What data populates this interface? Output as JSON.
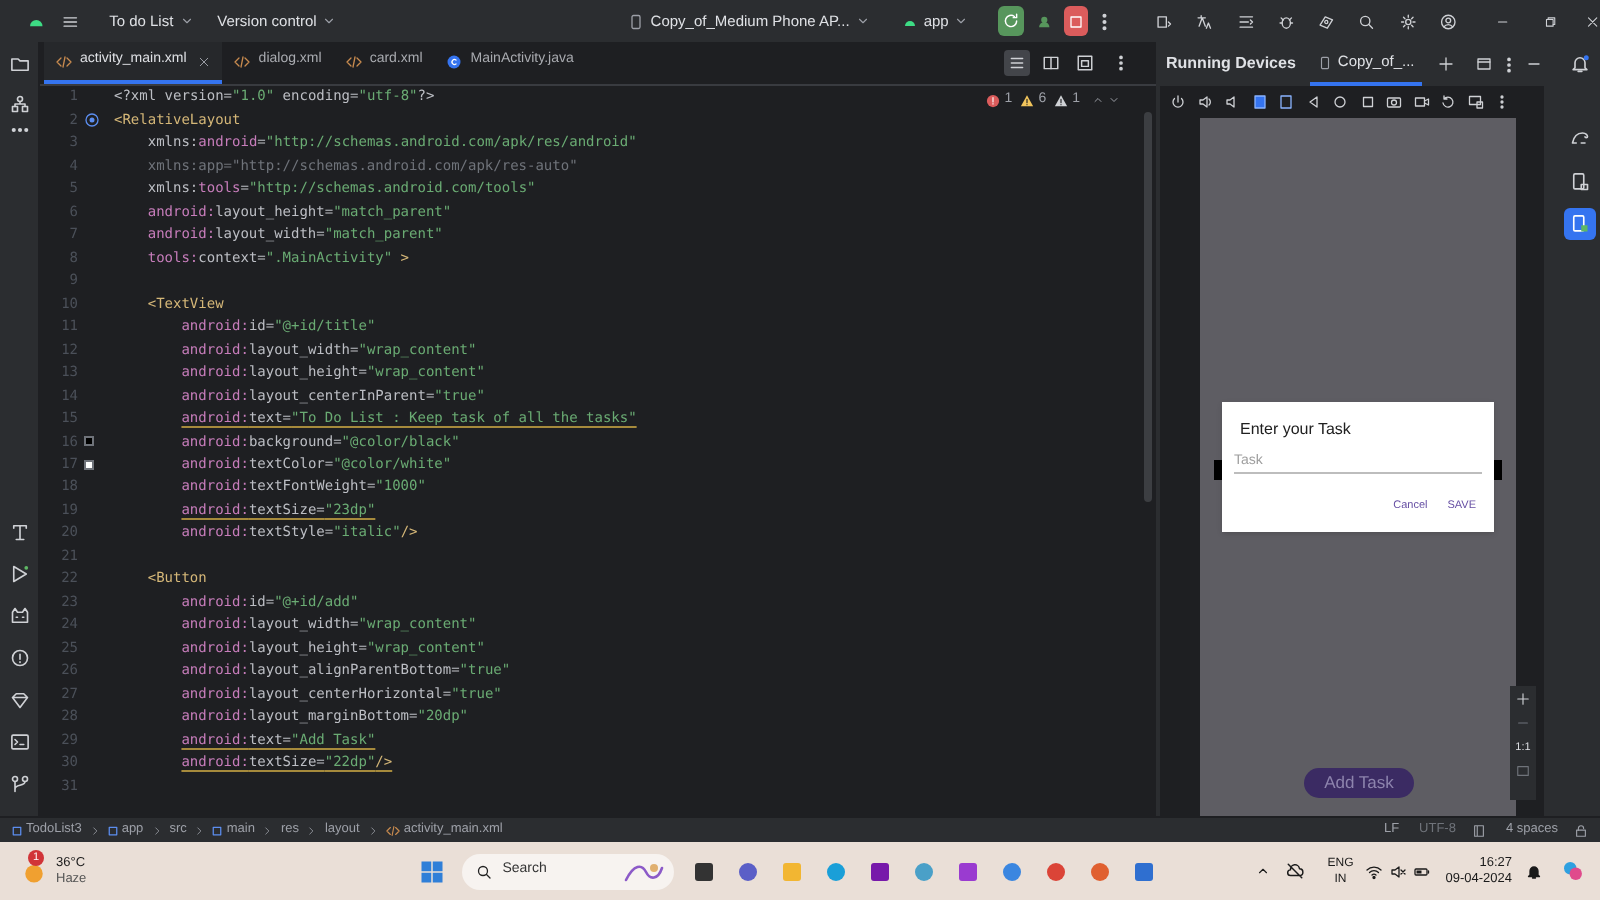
{
  "title_bar": {
    "project": "To do List",
    "vcs": "Version control",
    "device": "Copy_of_Medium Phone AP...",
    "run_config": "app"
  },
  "editor_tabs": [
    {
      "label": "activity_main.xml",
      "kind": "xml",
      "selected": true
    },
    {
      "label": "dialog.xml",
      "kind": "xml",
      "selected": false
    },
    {
      "label": "card.xml",
      "kind": "xml",
      "selected": false
    },
    {
      "label": "MainActivity.java",
      "kind": "java",
      "selected": false
    }
  ],
  "inspections": [
    {
      "kind": "error",
      "count": "1"
    },
    {
      "kind": "warning",
      "count": "6"
    },
    {
      "kind": "weak",
      "count": "1"
    }
  ],
  "code": [
    {
      "number": "1",
      "segments": [
        {
          "kind": "punct",
          "text": "<?xml "
        },
        {
          "kind": "attr",
          "text": "version="
        },
        {
          "kind": "value",
          "text": "\"1.0\""
        },
        {
          "kind": "attr",
          "text": " encoding="
        },
        {
          "kind": "value",
          "text": "\"utf-8\""
        },
        {
          "kind": "punct",
          "text": "?>"
        }
      ]
    },
    {
      "number": "2",
      "gutter": {
        "kind": "icon"
      },
      "segments": [
        {
          "kind": "tag",
          "text": "<RelativeLayout"
        }
      ]
    },
    {
      "number": "3",
      "segments": [
        {
          "kind": "attr",
          "text": "    xmlns:"
        },
        {
          "kind": "ns",
          "text": "android"
        },
        {
          "kind": "attr",
          "text": "="
        },
        {
          "kind": "value",
          "text": "\"http://schemas.android.com/apk/res/android\""
        }
      ]
    },
    {
      "number": "4",
      "segments": [
        {
          "kind": "unused",
          "text": "    xmlns:app=\"http://schemas.android.com/apk/res-auto\""
        }
      ]
    },
    {
      "number": "5",
      "segments": [
        {
          "kind": "attr",
          "text": "    xmlns:"
        },
        {
          "kind": "ns",
          "text": "tools"
        },
        {
          "kind": "attr",
          "text": "="
        },
        {
          "kind": "value",
          "text": "\"http://schemas.android.com/tools\""
        }
      ]
    },
    {
      "number": "6",
      "segments": [
        {
          "kind": "ns",
          "text": "    android:"
        },
        {
          "kind": "attr",
          "text": "layout_height="
        },
        {
          "kind": "value",
          "text": "\"match_parent\""
        }
      ]
    },
    {
      "number": "7",
      "segments": [
        {
          "kind": "ns",
          "text": "    android:"
        },
        {
          "kind": "attr",
          "text": "layout_width="
        },
        {
          "kind": "value",
          "text": "\"match_parent\""
        }
      ]
    },
    {
      "number": "8",
      "segments": [
        {
          "kind": "ns",
          "text": "    tools:"
        },
        {
          "kind": "attr",
          "text": "context="
        },
        {
          "kind": "value",
          "text": "\".MainActivity\""
        },
        {
          "kind": "tag",
          "text": " >"
        }
      ]
    },
    {
      "number": "9"
    },
    {
      "number": "10",
      "segments": [
        {
          "kind": "tag",
          "text": "    <TextView"
        }
      ]
    },
    {
      "number": "11",
      "segments": [
        {
          "kind": "ns",
          "text": "        android:"
        },
        {
          "kind": "attr",
          "text": "id="
        },
        {
          "kind": "value",
          "text": "\"@+id/title\""
        }
      ]
    },
    {
      "number": "12",
      "segments": [
        {
          "kind": "ns",
          "text": "        android:"
        },
        {
          "kind": "attr",
          "text": "layout_width="
        },
        {
          "kind": "value",
          "text": "\"wrap_content\""
        }
      ]
    },
    {
      "number": "13",
      "segments": [
        {
          "kind": "ns",
          "text": "        android:"
        },
        {
          "kind": "attr",
          "text": "layout_height="
        },
        {
          "kind": "value",
          "text": "\"wrap_content\""
        }
      ]
    },
    {
      "number": "14",
      "segments": [
        {
          "kind": "ns",
          "text": "        android:"
        },
        {
          "kind": "attr",
          "text": "layout_centerInParent="
        },
        {
          "kind": "value",
          "text": "\"true\""
        }
      ]
    },
    {
      "number": "15",
      "warning": true,
      "segments": [
        {
          "kind": "ns",
          "text": "        android:"
        },
        {
          "kind": "attr",
          "text": "text="
        },
        {
          "kind": "value",
          "text": "\"To Do List : Keep task of all the tasks\""
        }
      ]
    },
    {
      "number": "16",
      "gutter": {
        "kind": "swatch",
        "color": "#000000"
      },
      "segments": [
        {
          "kind": "ns",
          "text": "        android:"
        },
        {
          "kind": "attr",
          "text": "background="
        },
        {
          "kind": "value",
          "text": "\"@color/black\""
        }
      ]
    },
    {
      "number": "17",
      "gutter": {
        "kind": "swatch",
        "color": "#ffffff"
      },
      "segments": [
        {
          "kind": "ns",
          "text": "        android:"
        },
        {
          "kind": "attr",
          "text": "textColor="
        },
        {
          "kind": "value",
          "text": "\"@color/white\""
        }
      ]
    },
    {
      "number": "18",
      "segments": [
        {
          "kind": "ns",
          "text": "        android:"
        },
        {
          "kind": "attr",
          "text": "textFontWeight="
        },
        {
          "kind": "value",
          "text": "\"1000\""
        }
      ]
    },
    {
      "number": "19",
      "warning": true,
      "segments": [
        {
          "kind": "ns",
          "text": "        android:"
        },
        {
          "kind": "attr",
          "text": "textSize="
        },
        {
          "kind": "value",
          "text": "\"23dp\""
        }
      ]
    },
    {
      "number": "20",
      "segments": [
        {
          "kind": "ns",
          "text": "        android:"
        },
        {
          "kind": "attr",
          "text": "textStyle="
        },
        {
          "kind": "value",
          "text": "\"italic\""
        },
        {
          "kind": "tag",
          "text": "/>"
        }
      ]
    },
    {
      "number": "21"
    },
    {
      "number": "22",
      "segments": [
        {
          "kind": "tag",
          "text": "    <Button"
        }
      ]
    },
    {
      "number": "23",
      "segments": [
        {
          "kind": "ns",
          "text": "        android:"
        },
        {
          "kind": "attr",
          "text": "id="
        },
        {
          "kind": "value",
          "text": "\"@+id/add\""
        }
      ]
    },
    {
      "number": "24",
      "segments": [
        {
          "kind": "ns",
          "text": "        android:"
        },
        {
          "kind": "attr",
          "text": "layout_width="
        },
        {
          "kind": "value",
          "text": "\"wrap_content\""
        }
      ]
    },
    {
      "number": "25",
      "segments": [
        {
          "kind": "ns",
          "text": "        android:"
        },
        {
          "kind": "attr",
          "text": "layout_height="
        },
        {
          "kind": "value",
          "text": "\"wrap_content\""
        }
      ]
    },
    {
      "number": "26",
      "segments": [
        {
          "kind": "ns",
          "text": "        android:"
        },
        {
          "kind": "attr",
          "text": "layout_alignParentBottom="
        },
        {
          "kind": "value",
          "text": "\"true\""
        }
      ]
    },
    {
      "number": "27",
      "segments": [
        {
          "kind": "ns",
          "text": "        android:"
        },
        {
          "kind": "attr",
          "text": "layout_centerHorizontal="
        },
        {
          "kind": "value",
          "text": "\"true\""
        }
      ]
    },
    {
      "number": "28",
      "segments": [
        {
          "kind": "ns",
          "text": "        android:"
        },
        {
          "kind": "attr",
          "text": "layout_marginBottom="
        },
        {
          "kind": "value",
          "text": "\"20dp\""
        }
      ]
    },
    {
      "number": "29",
      "warning": true,
      "segments": [
        {
          "kind": "ns",
          "text": "        android:"
        },
        {
          "kind": "attr",
          "text": "text="
        },
        {
          "kind": "value",
          "text": "\"Add Task\""
        }
      ]
    },
    {
      "number": "30",
      "warning": true,
      "segments": [
        {
          "kind": "ns",
          "text": "        android:"
        },
        {
          "kind": "attr",
          "text": "textSize="
        },
        {
          "kind": "value",
          "text": "\"22dp\""
        },
        {
          "kind": "tag",
          "text": "/>"
        }
      ]
    },
    {
      "number": "31"
    }
  ],
  "running_devices": {
    "title": "Running Devices",
    "tab": "Copy_of_...",
    "dialog": {
      "title": "Enter your Task",
      "placeholder": "Task",
      "buttons": [
        "Cancel",
        "SAVE"
      ]
    },
    "app_button": "Add Task",
    "zoom_label": "1:1"
  },
  "breadcrumbs": [
    {
      "label": "TodoList3",
      "kind": "module"
    },
    {
      "label": "app",
      "kind": "module"
    },
    {
      "label": "src",
      "kind": "folder"
    },
    {
      "label": "main",
      "kind": "module"
    },
    {
      "label": "res",
      "kind": "folder"
    },
    {
      "label": "layout",
      "kind": "folder"
    },
    {
      "label": "activity_main.xml",
      "kind": "xml"
    }
  ],
  "status": {
    "line_ending": "LF",
    "encoding": "UTF-8",
    "indent": "4 spaces"
  },
  "taskbar": {
    "weather": {
      "temperature": "36°C",
      "condition": "Haze",
      "badge": "1"
    },
    "search": "Search",
    "language": [
      "ENG",
      "IN"
    ],
    "time": "16:27",
    "date": "09-04-2024"
  }
}
